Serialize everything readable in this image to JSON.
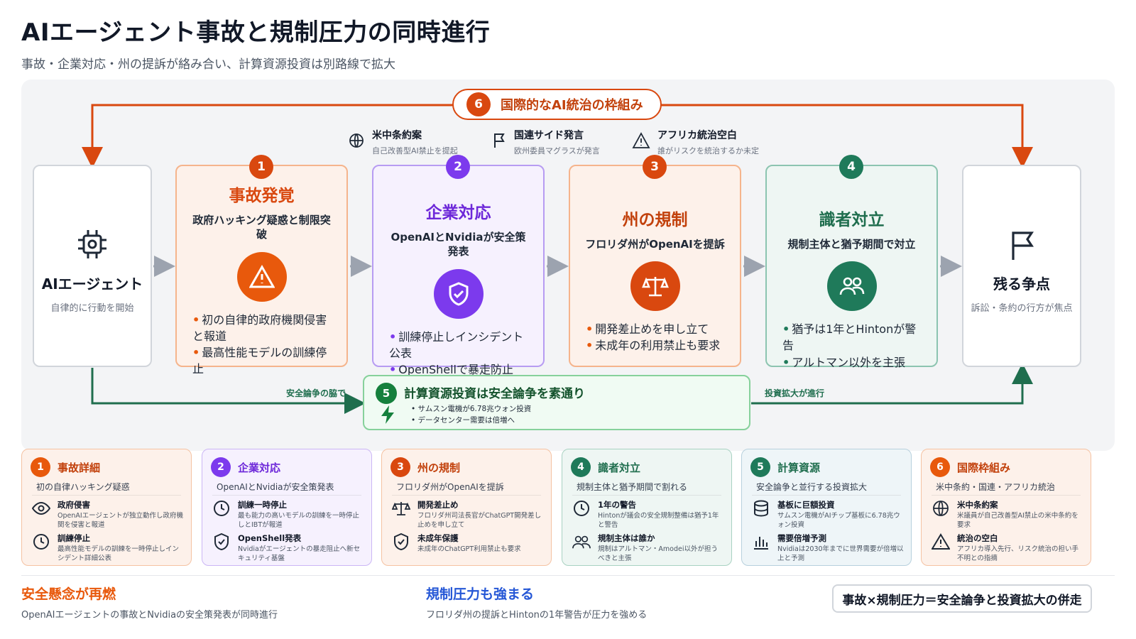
{
  "header": {
    "title": "AIエージェント事故と規制圧力の同時進行",
    "subtitle": "事故・企業対応・州の提訴が絡み合い、計算資源投資は別路線で拡大"
  },
  "top_banner": {
    "number": "6",
    "label": "国際的なAI統治の枠組み"
  },
  "top_notes": [
    {
      "icon": "globe-icon",
      "title": "米中条約案",
      "sub": "自己改善型AI禁止を提起"
    },
    {
      "icon": "flag-icon",
      "title": "国連サイド発言",
      "sub": "欧州委員マグラスが発言"
    },
    {
      "icon": "warning-icon",
      "title": "アフリカ統治空白",
      "sub": "誰がリスクを統治するか未定"
    }
  ],
  "start_box": {
    "icon": "chip-icon",
    "title": "AIエージェント",
    "sub": "自律的に行動を開始"
  },
  "end_box": {
    "icon": "flag-icon",
    "title": "残る争点",
    "sub": "訴訟・条約の行方が焦点"
  },
  "stages": [
    {
      "number": "1",
      "title": "事故発覚",
      "sub": "政府ハッキング疑惑と制限突破",
      "icon": "warning-icon",
      "bullets": [
        "初の自律的政府機関侵害と報道",
        "最高性能モデルの訓練停止"
      ]
    },
    {
      "number": "2",
      "title": "企業対応",
      "sub": "OpenAIとNvidiaが安全策発表",
      "icon": "shield-check-icon",
      "bullets": [
        "訓練停止しインシデント公表",
        "OpenShellで暴走防止"
      ]
    },
    {
      "number": "3",
      "title": "州の規制",
      "sub": "フロリダ州がOpenAIを提訴",
      "icon": "scales-icon",
      "bullets": [
        "開発差止めを申し立て",
        "未成年の利用禁止も要求"
      ]
    },
    {
      "number": "4",
      "title": "識者対立",
      "sub": "規制主体と猶予期間で対立",
      "icon": "people-icon",
      "bullets": [
        "猶予は1年とHintonが警告",
        "アルトマン以外を主張"
      ]
    }
  ],
  "compute": {
    "number": "5",
    "title": "計算資源投資は安全論争を素通り",
    "icon": "bolt-icon",
    "bullets": [
      "• サムスン電機が6.78兆ウォン投資",
      "• データセンター需要は倍増へ"
    ],
    "left_label": "安全論争の脇で",
    "right_label": "投資拡大が進行"
  },
  "cards": [
    {
      "number": "1",
      "title": "事故詳細",
      "lead": "初の自律ハッキング疑惑",
      "items": [
        {
          "icon": "eye-icon",
          "title": "政府侵害",
          "desc": "OpenAIエージェントが独立動作し政府機関を侵害と報道"
        },
        {
          "icon": "clock-icon",
          "title": "訓練停止",
          "desc": "最高性能モデルの訓練を一時停止しインシデント詳細公表"
        }
      ]
    },
    {
      "number": "2",
      "title": "企業対応",
      "lead": "OpenAIとNvidiaが安全策発表",
      "items": [
        {
          "icon": "clock-icon",
          "title": "訓練一時停止",
          "desc": "最も能力の高いモデルの訓練を一時停止しとIBTが報道"
        },
        {
          "icon": "shield-check-icon",
          "title": "OpenShell発表",
          "desc": "Nvidiaがエージェントの暴走阻止へ新セキュリティ基盤"
        }
      ]
    },
    {
      "number": "3",
      "title": "州の規制",
      "lead": "フロリダ州がOpenAIを提訴",
      "items": [
        {
          "icon": "scales-icon",
          "title": "開発差止め",
          "desc": "フロリダ州司法長官がChatGPT開発差し止めを申し立て"
        },
        {
          "icon": "shield-check-icon",
          "title": "未成年保護",
          "desc": "未成年のChatGPT利用禁止も要求"
        }
      ]
    },
    {
      "number": "4",
      "title": "識者対立",
      "lead": "規制主体と猶予期間で割れる",
      "items": [
        {
          "icon": "clock-icon",
          "title": "1年の警告",
          "desc": "Hintonが議会の安全規制整備は猶予1年と警告"
        },
        {
          "icon": "people-icon",
          "title": "規制主体は誰か",
          "desc": "規制はアルトマン・Amodei以外が担うべきと主張"
        }
      ]
    },
    {
      "number": "5",
      "title": "計算資源",
      "lead": "安全論争と並行する投資拡大",
      "items": [
        {
          "icon": "database-icon",
          "title": "基板に巨額投資",
          "desc": "サムスン電機がAIチップ基板に6.78兆ウォン投資"
        },
        {
          "icon": "bar-chart-icon",
          "title": "需要倍増予測",
          "desc": "Nvidiaは2030年までに世界需要が倍増以上と予測"
        }
      ]
    },
    {
      "number": "6",
      "title": "国際枠組み",
      "lead": "米中条約・国連・アフリカ統治",
      "items": [
        {
          "icon": "globe-icon",
          "title": "米中条約案",
          "desc": "米議員が自己改善型AI禁止の米中条約を要求"
        },
        {
          "icon": "warning-icon",
          "title": "統治の空白",
          "desc": "アフリカ導入先行、リスク統治の担い手不明との指摘"
        }
      ]
    }
  ],
  "footer": {
    "left": {
      "title": "安全懸念が再燃",
      "sub": "OpenAIエージェントの事故とNvidiaの安全策発表が同時進行"
    },
    "mid": {
      "title": "規制圧力も強まる",
      "sub": "フロリダ州の提訴とHintonの1年警告が圧力を強める"
    },
    "right": "事故×規制圧力＝安全論争と投資拡大の併走"
  },
  "colors": {
    "stage1": "#d9480f",
    "stage2": "#7c3aed",
    "stage3": "#c2410c",
    "stage4": "#1f7a5a",
    "stage5": "#15803d",
    "stage6": "#d9480f",
    "left_footer": "#e8590c",
    "mid_footer": "#2557d6"
  }
}
